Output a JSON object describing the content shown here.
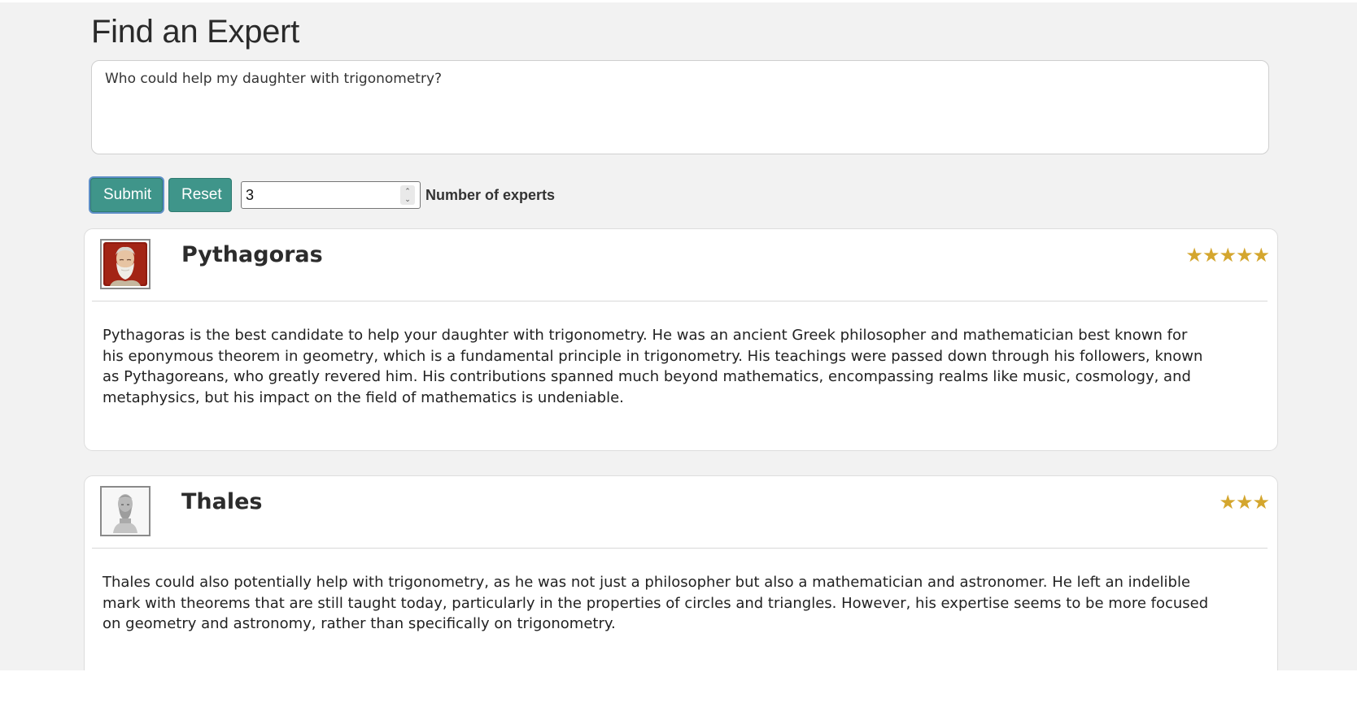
{
  "page": {
    "title": "Find an Expert"
  },
  "query": {
    "value": "Who could help my daughter with trigonometry?"
  },
  "controls": {
    "submit_label": "Submit",
    "reset_label": "Reset",
    "num_experts_value": "3",
    "num_experts_label": "Number of experts"
  },
  "experts": [
    {
      "name": "Pythagoras",
      "stars": "★★★★★",
      "rating": 5,
      "description": "Pythagoras is the best candidate to help your daughter with trigonometry. He was an ancient Greek philosopher and mathematician best known for his eponymous theorem in geometry, which is a fundamental principle in trigonometry. His teachings were passed down through his followers, known as Pythagoreans, who greatly revered him. His contributions spanned much beyond mathematics, encompassing realms like music, cosmology, and metaphysics, but his impact on the field of mathematics is undeniable.",
      "avatar_icon": "pythagoras-portrait-icon"
    },
    {
      "name": "Thales",
      "stars": "★★★",
      "rating": 3,
      "description": "Thales could also potentially help with trigonometry, as he was not just a philosopher but also a mathematician and astronomer. He left an indelible mark with theorems that are still taught today, particularly in the properties of circles and triangles. However, his expertise seems to be more focused on geometry and astronomy, rather than specifically on trigonometry.",
      "avatar_icon": "thales-bust-icon"
    }
  ],
  "colors": {
    "button": "#3f958a",
    "star": "#d4a62e",
    "background": "#f2f2f2"
  }
}
